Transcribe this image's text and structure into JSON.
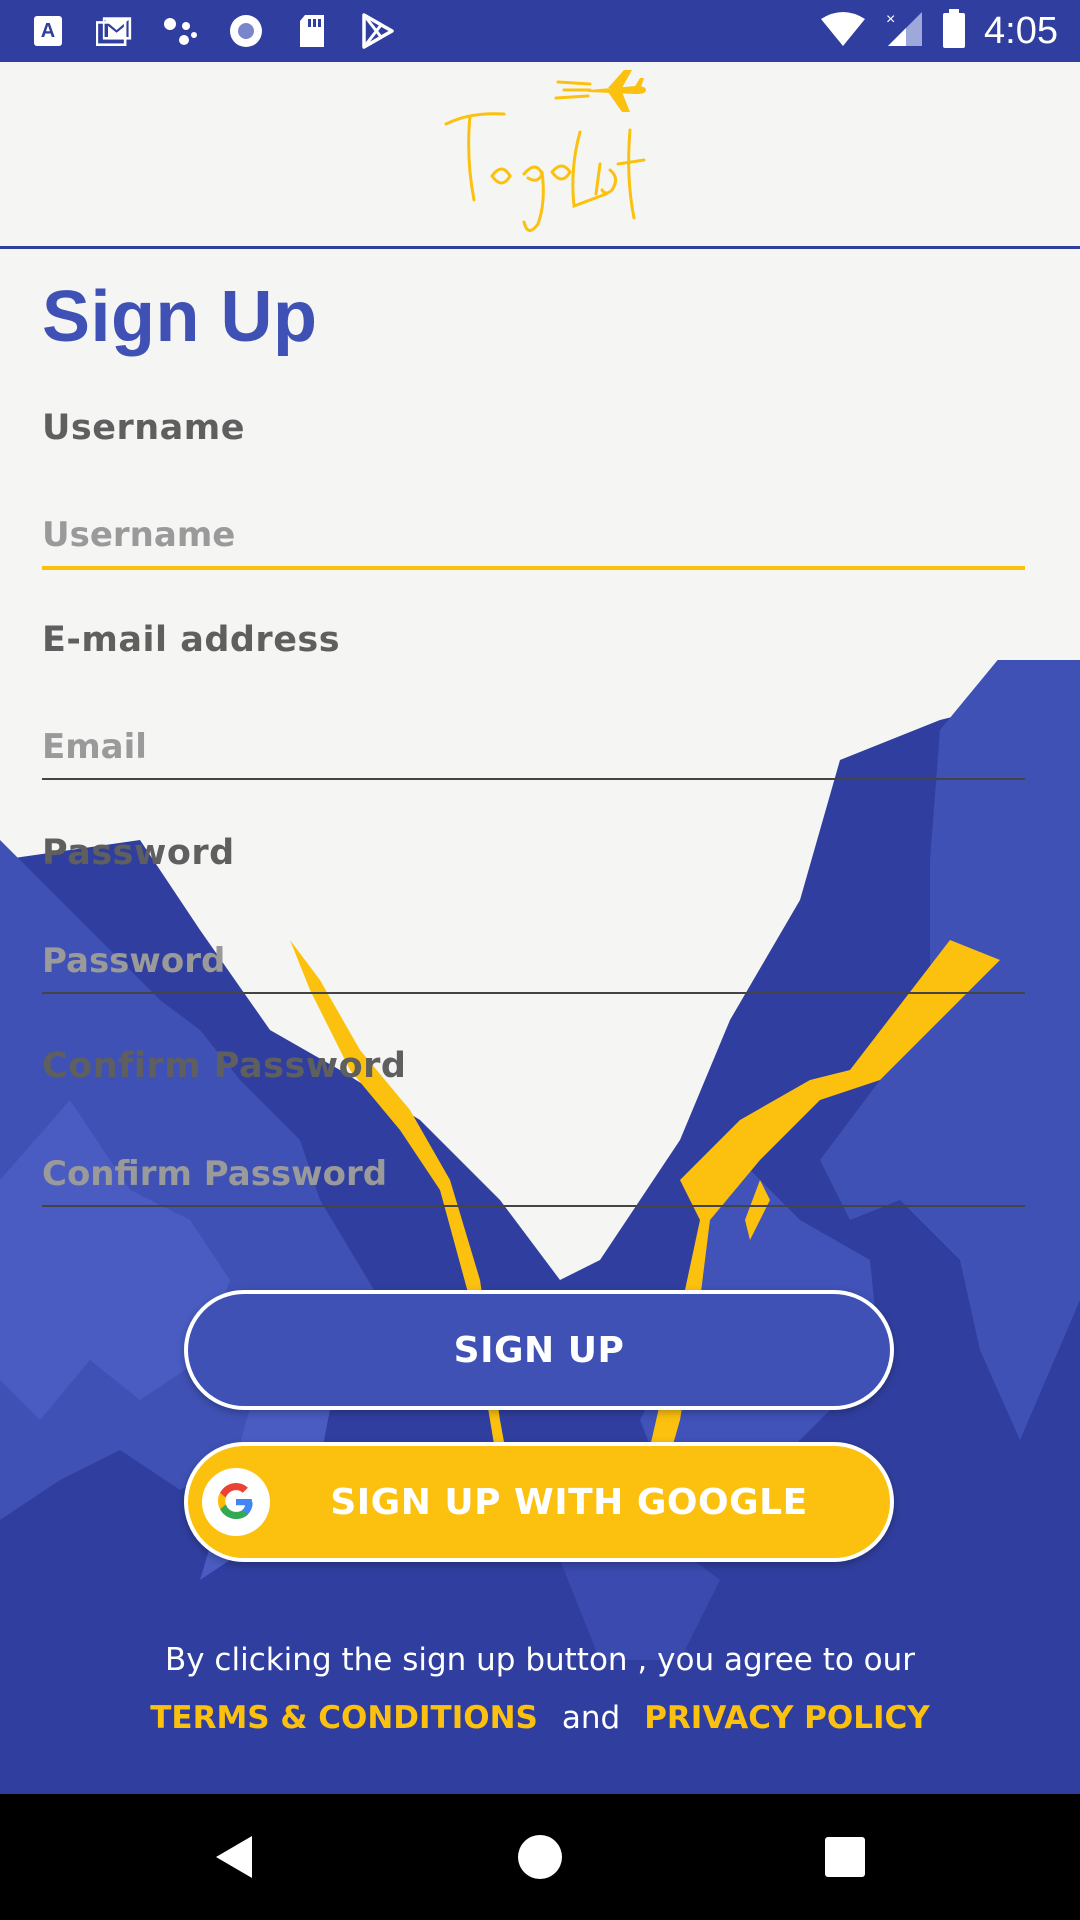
{
  "status_bar": {
    "time": "4:05",
    "icons": [
      "a-notification-icon",
      "gmail-icon",
      "assistant-icon",
      "circle-app-icon",
      "sd-card-icon",
      "play-store-icon",
      "wifi-icon",
      "signal-icon",
      "battery-icon"
    ]
  },
  "app_bar": {
    "logo_text": "Togo List",
    "brand_color": "#fbc10e"
  },
  "form": {
    "title": "Sign Up",
    "username": {
      "label": "Username",
      "placeholder": "Username",
      "value": ""
    },
    "email": {
      "label": "E-mail address",
      "placeholder": "Email",
      "value": ""
    },
    "password": {
      "label": "Password",
      "placeholder": "Password",
      "value": ""
    },
    "confirm_password": {
      "label": "Confirm Password",
      "placeholder": "Confirm Password",
      "value": ""
    }
  },
  "buttons": {
    "signup": "SIGN UP",
    "google": "SIGN UP WITH GOOGLE"
  },
  "footer": {
    "agree_text": "By clicking the sign up button , you agree to our",
    "terms": "TERMS & CONDITIONS",
    "and": "and",
    "privacy": "PRIVACY POLICY"
  },
  "colors": {
    "primary": "#3f51b5",
    "primary_dark": "#303f9f",
    "accent": "#fbc10e"
  }
}
